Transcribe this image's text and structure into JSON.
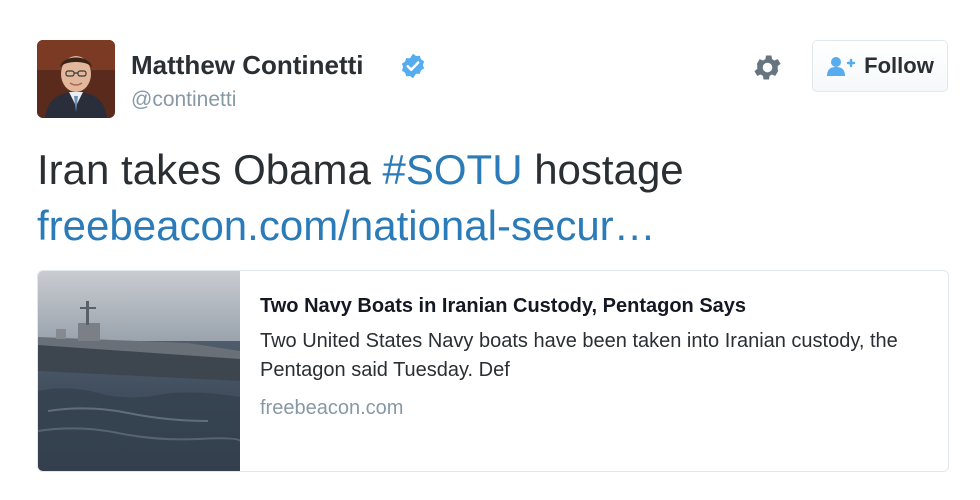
{
  "author": {
    "name": "Matthew Continetti",
    "handle": "@continetti",
    "verified_icon": "verified-badge-icon"
  },
  "actions": {
    "settings_icon": "gear-icon",
    "follow_label": "Follow",
    "follow_icon": "user-plus-icon"
  },
  "tweet": {
    "text_prefix": "Iran takes Obama ",
    "hashtag": "#SOTU",
    "text_suffix": " hostage",
    "link": "freebeacon.com/national-secur…"
  },
  "card": {
    "title": "Two Navy Boats in Iranian Custody, Pentagon Says",
    "description": "Two United States Navy boats have been taken into Iranian custody, the Pentagon said Tuesday. Def",
    "domain": "freebeacon.com"
  },
  "colors": {
    "link": "#2b7bb9",
    "verified": "#55acee",
    "text": "#292f33",
    "muted": "#8899a6"
  }
}
